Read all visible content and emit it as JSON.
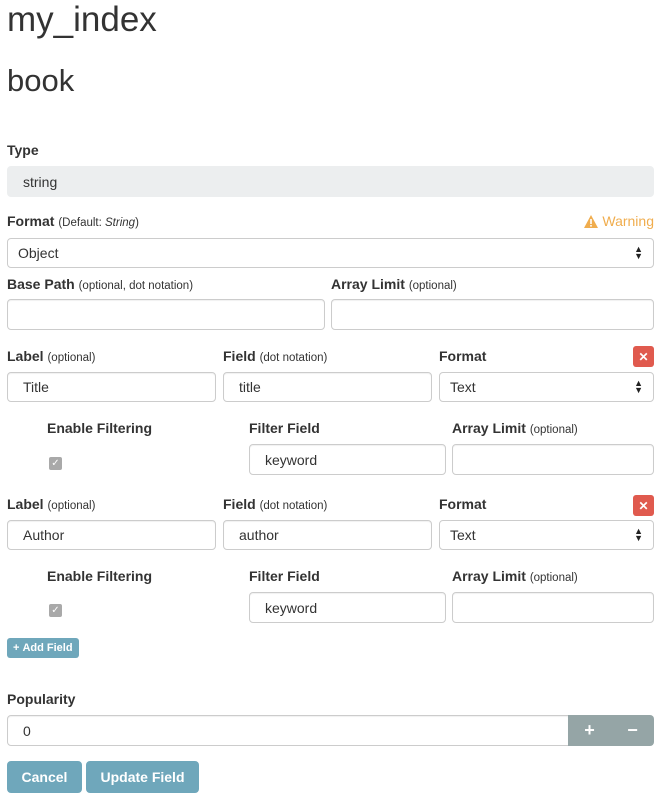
{
  "page": {
    "index_title": "my_index",
    "type_title": "book"
  },
  "type_field": {
    "label": "Type",
    "value": "string"
  },
  "format": {
    "label": "Format",
    "note_prefix": "(Default: ",
    "note_default": "String",
    "note_suffix": ")",
    "warning_text": "Warning",
    "selected": "Object",
    "warning_color": "#f0ad4e"
  },
  "base_path": {
    "label": "Base Path",
    "note": "(optional, dot notation)",
    "value": ""
  },
  "array_limit_top": {
    "label": "Array Limit",
    "note": "(optional)",
    "value": ""
  },
  "fields": [
    {
      "label_header": "Label",
      "label_note": "(optional)",
      "label_value": "Title",
      "field_header": "Field",
      "field_note": "(dot notation)",
      "field_value": "title",
      "format_header": "Format",
      "format_value": "Text",
      "enable_filtering_label": "Enable Filtering",
      "enable_filtering_checked": true,
      "filter_field_label": "Filter Field",
      "filter_field_value": "keyword",
      "array_limit_label": "Array Limit",
      "array_limit_note": "(optional)",
      "array_limit_value": ""
    },
    {
      "label_header": "Label",
      "label_note": "(optional)",
      "label_value": "Author",
      "field_header": "Field",
      "field_note": "(dot notation)",
      "field_value": "author",
      "format_header": "Format",
      "format_value": "Text",
      "enable_filtering_label": "Enable Filtering",
      "enable_filtering_checked": true,
      "filter_field_label": "Filter Field",
      "filter_field_value": "keyword",
      "array_limit_label": "Array Limit",
      "array_limit_note": "(optional)",
      "array_limit_value": ""
    }
  ],
  "add_field_button": "Add Field",
  "popularity": {
    "label": "Popularity",
    "value": "0",
    "plus": "+",
    "minus": "−"
  },
  "actions": {
    "cancel": "Cancel",
    "update": "Update Field"
  },
  "colors": {
    "accent": "#6fa7bb",
    "danger": "#e05a4e",
    "stepper": "#95a5a6",
    "readonly_bg": "#eceeef"
  }
}
